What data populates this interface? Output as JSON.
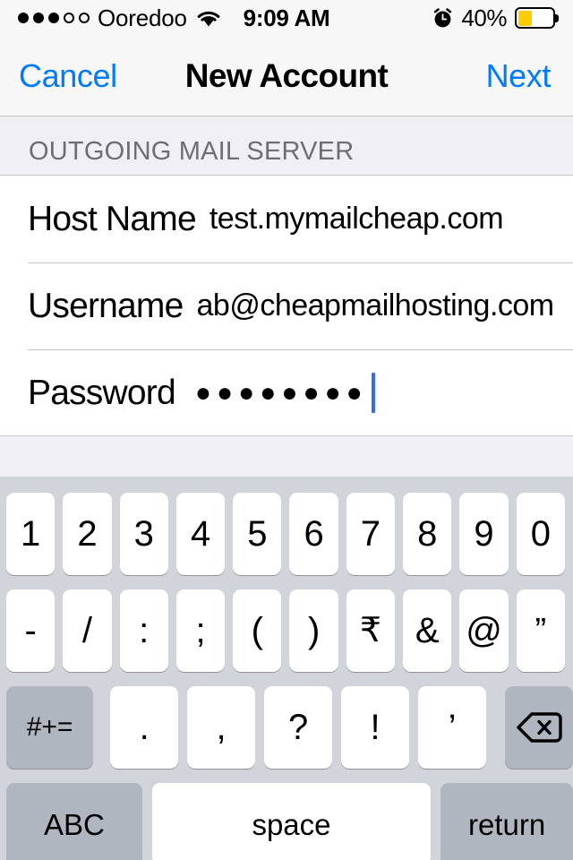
{
  "status_bar": {
    "signal_filled": 3,
    "signal_empty": 2,
    "carrier": "Ooredoo",
    "wifi_icon": "wifi-icon",
    "time": "9:09 AM",
    "alarm_icon": "alarm-clock-icon",
    "battery_percent": "40%",
    "battery_level": 40,
    "battery_color": "#FFCC00"
  },
  "nav": {
    "cancel_label": "Cancel",
    "title": "New Account",
    "next_label": "Next",
    "tint_color": "#007AFF"
  },
  "form": {
    "section_header": "OUTGOING MAIL SERVER",
    "rows": [
      {
        "label": "Host Name",
        "value": "test.mymailcheap.com",
        "name": "host-name"
      },
      {
        "label": "Username",
        "value": "ab@cheapmailhosting.com",
        "name": "username"
      },
      {
        "label": "Password",
        "value": "●●●●●●●●",
        "name": "password",
        "masked": true,
        "char_count": 8,
        "caret": true
      }
    ]
  },
  "keyboard": {
    "layout": "numeric-symbols",
    "row1": [
      "1",
      "2",
      "3",
      "4",
      "5",
      "6",
      "7",
      "8",
      "9",
      "0"
    ],
    "row2": [
      "-",
      "/",
      ":",
      ";",
      "(",
      ")",
      "₹",
      "&",
      "@",
      "”"
    ],
    "row3": {
      "shift_label": "#+=",
      "keys": [
        ".",
        ",",
        "?",
        "!",
        "’"
      ],
      "delete_icon": "backspace-delete-icon"
    },
    "row4": {
      "abc_label": "ABC",
      "space_label": "space",
      "return_label": "return"
    }
  }
}
